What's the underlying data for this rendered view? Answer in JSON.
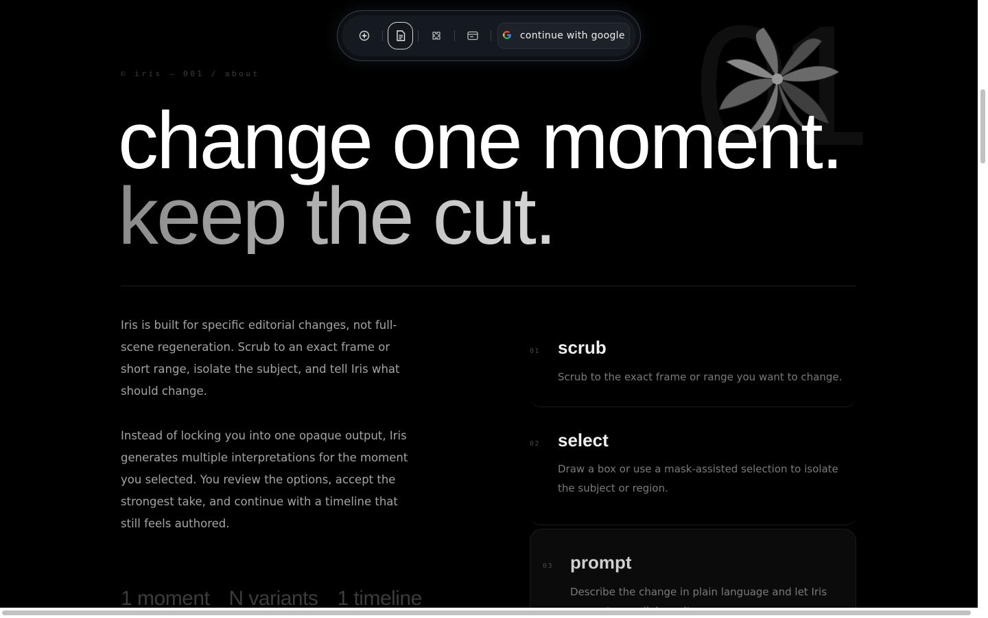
{
  "decor": {
    "number": "01"
  },
  "nav": {
    "icons": [
      "compass-icon",
      "document-icon",
      "puzzle-icon",
      "browser-window-icon"
    ],
    "active_index": 1,
    "google_label": "continue with google"
  },
  "crumb": "© iris — 001 / about",
  "headline": {
    "line1": "change one moment.",
    "line2": "keep the cut."
  },
  "paragraphs": [
    "Iris is built for specific editorial changes, not full-scene regeneration. Scrub to an exact frame or short range, isolate the subject, and tell Iris what should change.",
    "Instead of locking you into one opaque output, Iris generates multiple interpretations for the moment you selected. You review the options, accept the strongest take, and continue with a timeline that still feels authored."
  ],
  "stats": [
    "1 moment",
    "N variants",
    "1 timeline"
  ],
  "steps": [
    {
      "num": "01",
      "title": "scrub",
      "desc": "Scrub to the exact frame or range you want to change."
    },
    {
      "num": "02",
      "title": "select",
      "desc": "Draw a box or use a mask-assisted selection to isolate the subject or region."
    },
    {
      "num": "03",
      "title": "prompt",
      "desc": "Describe the change in plain language and let Iris generate parallel results."
    }
  ]
}
